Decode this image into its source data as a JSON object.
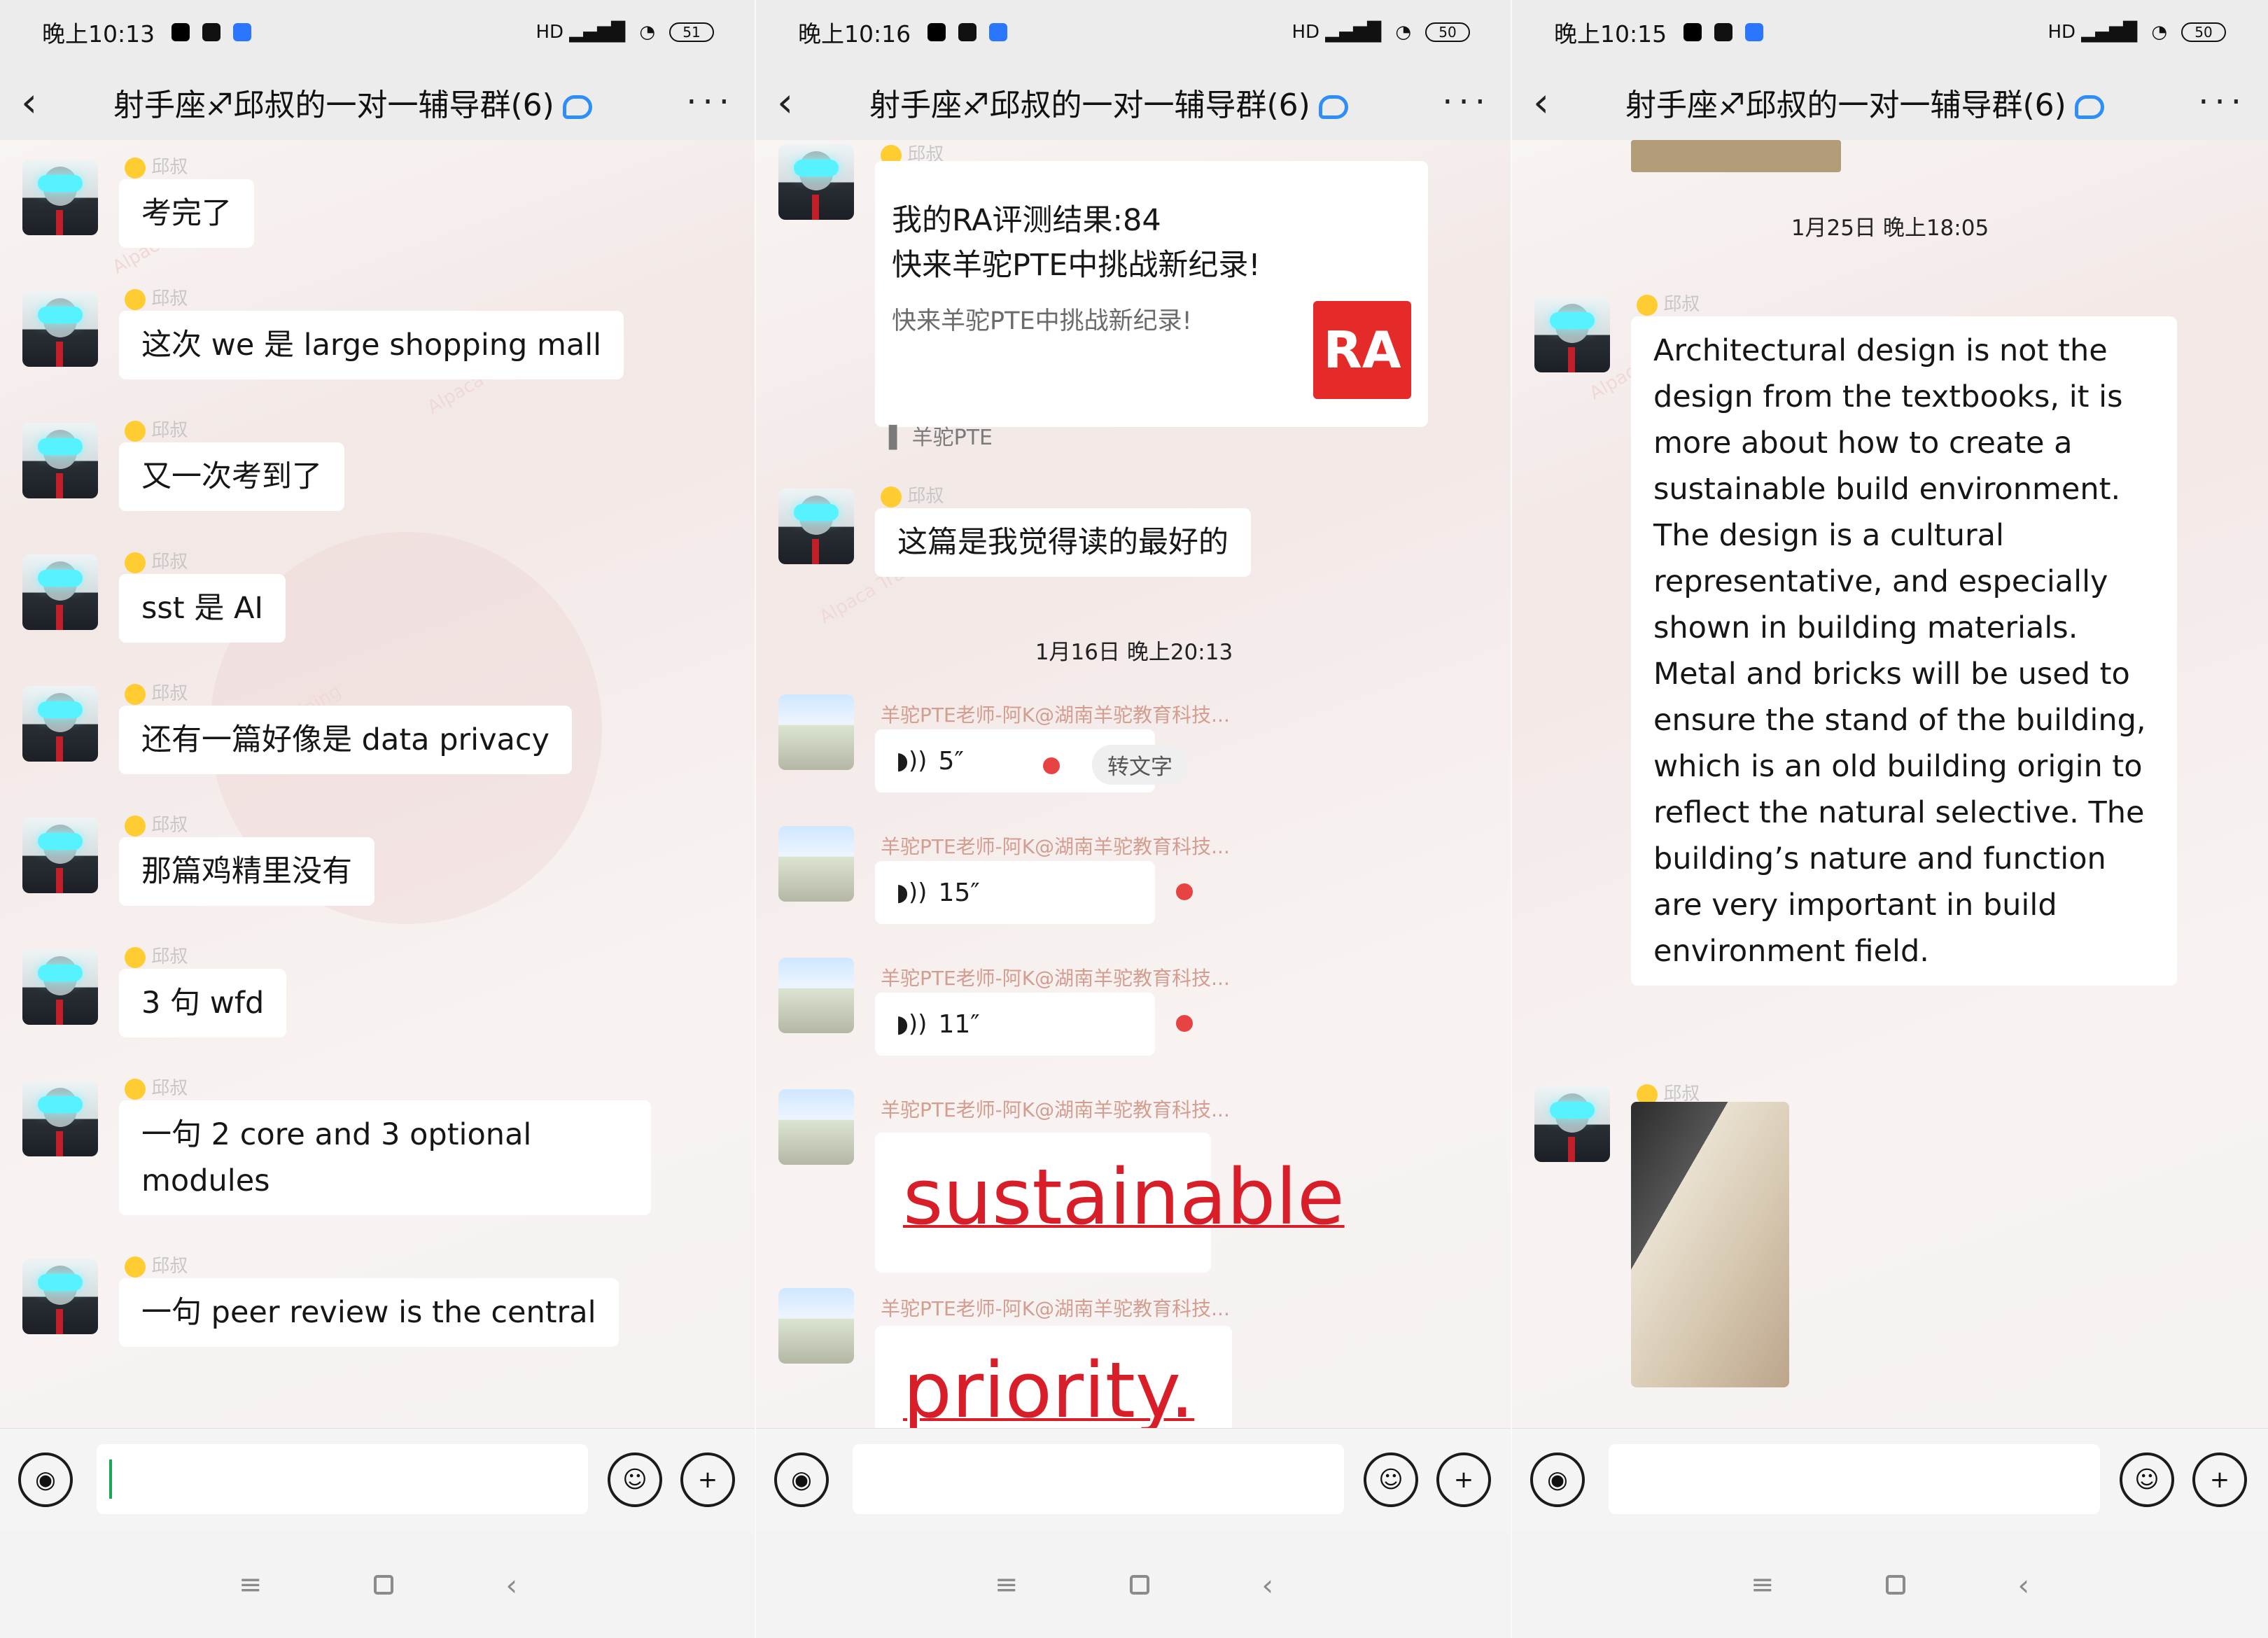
{
  "panels": [
    {
      "status": {
        "time": "晚上10:13",
        "battery": "51"
      },
      "chat_title": "射手座♐邱叔的一对一辅导群(6)",
      "messages": [
        {
          "nick": "邱叔",
          "text": "考完了"
        },
        {
          "nick": "邱叔",
          "text": "这次 we 是 large shopping mall"
        },
        {
          "nick": "邱叔",
          "text": "又一次考到了"
        },
        {
          "nick": "邱叔",
          "text": "sst 是 AI"
        },
        {
          "nick": "邱叔",
          "text": "还有一篇好像是 data privacy"
        },
        {
          "nick": "邱叔",
          "text": "那篇鸡精里没有"
        },
        {
          "nick": "邱叔",
          "text": "3 句 wfd"
        },
        {
          "nick": "邱叔",
          "text": "一句 2 core and 3 optional modules"
        },
        {
          "nick": "邱叔",
          "text": "一句 peer review is the central"
        }
      ]
    },
    {
      "status": {
        "time": "晚上10:16",
        "battery": "50"
      },
      "chat_title": "射手座♐邱叔的一对一辅导群(6)",
      "card": {
        "nick": "邱叔",
        "line1": "我的RA评测结果:84",
        "line2": "快来羊驼PTE中挑战新纪录!",
        "sub": "快来羊驼PTE中挑战新纪录!",
        "logo": "RA",
        "app": "羊驼PTE"
      },
      "msg2": {
        "nick": "邱叔",
        "text": "这篇是我觉得读的最好的"
      },
      "divider": "1月16日 晚上20:13",
      "voice_msgs": [
        {
          "teacher": "羊驼PTE老师-阿K@湖南羊驼教育科技...",
          "duration": "5″",
          "to_text": "转文字"
        },
        {
          "teacher": "羊驼PTE老师-阿K@湖南羊驼教育科技...",
          "duration": "15″"
        },
        {
          "teacher": "羊驼PTE老师-阿K@湖南羊驼教育科技...",
          "duration": "11″"
        }
      ],
      "image_msgs": [
        {
          "teacher": "羊驼PTE老师-阿K@湖南羊驼教育科技...",
          "word": "sustainable"
        },
        {
          "teacher": "羊驼PTE老师-阿K@湖南羊驼教育科技...",
          "word": "priority."
        }
      ]
    },
    {
      "status": {
        "time": "晚上10:15",
        "battery": "50"
      },
      "chat_title": "射手座♐邱叔的一对一辅导群(6)",
      "divider": "1月25日 晚上18:05",
      "long_msg": {
        "nick": "邱叔",
        "text": "Architectural design is not the design from the textbooks, it is more about how to create a sustainable build environment. The design is a cultural representative, and especially shown in building materials. Metal and bricks will be used to ensure the stand of the building, which is an old building origin to reflect the natural selective. The building’s nature and function are very important in build environment field."
      },
      "photo_msg": {
        "nick": "邱叔"
      }
    }
  ],
  "colors": {
    "accent_green": "#19a655",
    "red": "#e84343",
    "watermark": "#f0d8d8"
  },
  "icons": [
    "back-arrow-icon",
    "more-icon",
    "voice-icon",
    "emoji-icon",
    "plus-icon",
    "home-icon",
    "recent-apps-icon",
    "back-nav-icon"
  ]
}
